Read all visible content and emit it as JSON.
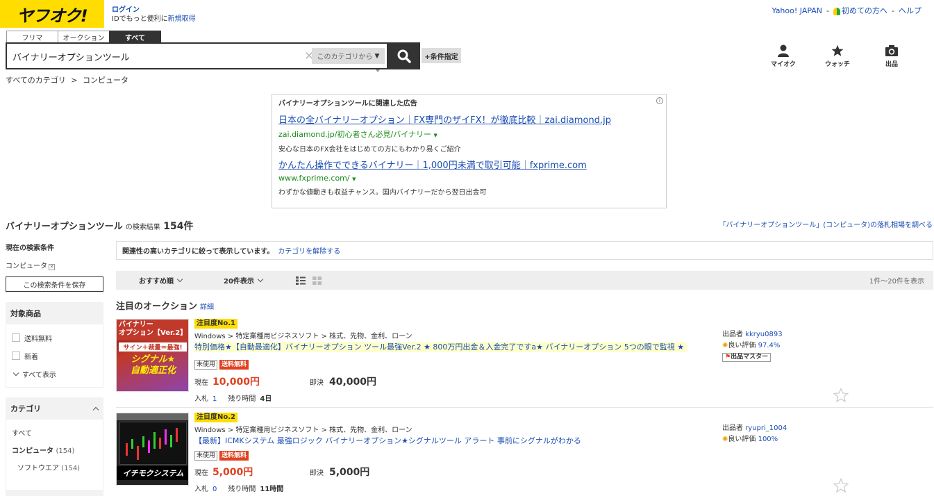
{
  "header": {
    "logo_text": "ヤフオク!",
    "login_label": "ログイン",
    "id_prefix": "IDでもっと便利に",
    "register_label": "新規取得",
    "top_links": [
      "Yahoo! JAPAN",
      "初めての方へ",
      "ヘルプ"
    ],
    "separator": "-"
  },
  "tabs": [
    {
      "label": "フリマ",
      "active": false
    },
    {
      "label": "オークション",
      "active": false
    },
    {
      "label": "すべて",
      "active": true
    }
  ],
  "search": {
    "value": "バイナリーオプションツール",
    "category_select": "このカテゴリから",
    "condition_button": "+条件指定"
  },
  "breadcrumb": {
    "items": [
      "すべてのカテゴリ",
      "コンピュータ"
    ],
    "separator": ">"
  },
  "nav_icons": [
    {
      "label": "マイオク",
      "icon": "person-icon"
    },
    {
      "label": "ウォッチ",
      "icon": "star-icon"
    },
    {
      "label": "出品",
      "icon": "camera-icon"
    }
  ],
  "ad": {
    "title": "バイナリーオプションツールに関連した広告",
    "items": [
      {
        "headline": "日本の全バイナリーオプション｜FX専門のザイFX！が徹底比較｜zai.diamond.jp",
        "url": "zai.diamond.jp/初心者さん必見/バイナリー",
        "desc": "安心な日本のFX会社をはじめての方にもわかり易くご紹介"
      },
      {
        "headline": "かんたん操作でできるバイナリー｜1,000円未満で取引可能｜fxprime.com",
        "url": "www.fxprime.com/",
        "desc": "わずかな値動きも収益チャンス。国内バイナリーだから翌日出金可"
      }
    ]
  },
  "results": {
    "query": "バイナリーオプションツール",
    "label": "の検索結果",
    "count": "154件",
    "market_link": "「バイナリーオプションツール」(コンピュータ)の落札相場を調べる"
  },
  "sidebar": {
    "current_label": "現在の検索条件",
    "current_category": "コンピュータ",
    "save_button": "この検索条件を保存",
    "target_title": "対象商品",
    "target_items": [
      "送料無料",
      "新着"
    ],
    "show_all": "すべて表示",
    "category_title": "カテゴリ",
    "categories": [
      {
        "label": "すべて",
        "count": ""
      },
      {
        "label": "コンピュータ",
        "count": "(154)"
      },
      {
        "label": "ソフトウエア",
        "count": "(154)"
      }
    ]
  },
  "notice": {
    "text": "関連性の高いカテゴリに絞って表示しています。",
    "link": "カテゴリを解除する"
  },
  "sortbar": {
    "sort": "おすすめ順",
    "per_page": "20件表示",
    "range": "1件〜20件を表示"
  },
  "featured": {
    "title": "注目のオークション",
    "detail_link": "詳細"
  },
  "items": [
    {
      "badge": "注目度No.1",
      "category": "Windows > 特定業種用ビジネスソフト > 株式、先物、金利、ローン",
      "title": "特別価格★【自動最適化】バイナリーオプション ツール最強Ver.2 ★ 800万円出金＆入金完了ですa★ バイナリーオプション 5つの眼で監視 ★",
      "tags": [
        "未使用",
        "送料無料"
      ],
      "current_label": "現在",
      "current_price": "10,000円",
      "buy_label": "即決",
      "buy_price": "40,000円",
      "bids_label": "入札",
      "bids": "1",
      "remaining_label": "残り時間",
      "remaining": "4日",
      "seller_label": "出品者",
      "seller": "kkryu0893",
      "rating_label": "良い評価",
      "rating": "97.4%",
      "master": "出品マスター",
      "thumb_lines": [
        "バイナリー",
        "オプション【Ver.2】",
        "サイン＋裁量＝最強!",
        "シグナル★",
        "自動適正化"
      ]
    },
    {
      "badge": "注目度No.2",
      "category": "Windows > 特定業種用ビジネスソフト > 株式、先物、金利、ローン",
      "title": "【最新】ICMKシステム 最強ロジック バイナリーオプション★シグナルツール アラート 事前にシグナルがわかる",
      "tags": [
        "未使用",
        "送料無料"
      ],
      "current_label": "現在",
      "current_price": "5,000円",
      "buy_label": "即決",
      "buy_price": "5,000円",
      "bids_label": "入札",
      "bids": "0",
      "remaining_label": "残り時間",
      "remaining": "11時間",
      "seller_label": "出品者",
      "seller": "ryupri_1004",
      "rating_label": "良い評価",
      "rating": "100%",
      "thumb_lines": [
        "イチモクシステム"
      ]
    }
  ],
  "colors": {
    "brand": "#ffdd00",
    "link": "#1a4db3",
    "price": "#e0411f",
    "url_green": "#1a8a1a"
  }
}
